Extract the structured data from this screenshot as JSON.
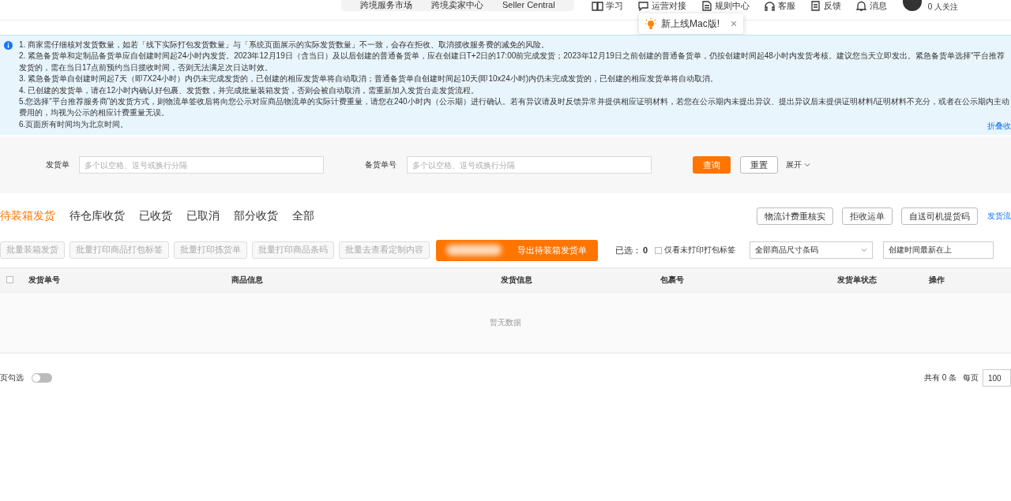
{
  "top_nav": {
    "links": [
      "跨境服务市场",
      "跨境卖家中心",
      "Seller Central"
    ],
    "items": [
      {
        "label": "学习"
      },
      {
        "label": "运营对接"
      },
      {
        "label": "规则中心"
      },
      {
        "label": "客服"
      },
      {
        "label": "反馈"
      },
      {
        "label": "消息"
      }
    ],
    "follow": "0 人关注"
  },
  "tooltip": {
    "text": "新上线Mac版!",
    "close": "×"
  },
  "notice": {
    "lines": [
      "1. 商家需仔细核对发货数量，如若「线下实际打包发货数量」与「系统页面展示的实际发货数量」不一致，会存在拒收、取消揽收服务费的减免的风险。",
      "2. 紧急备货单和定制品备货单应自创建时间起24小时内发货。2023年12月19日（含当日）及以后创建的普通备货单，应在创建日T+2日的17:00前完成发货；2023年12月19日之前创建的普通备货单，仍按创建时间起48小时内发货考核。建议您当天立即发出。紧急备货单选择“平台推荐",
      "发货的，需在当日17点前预约当日揽收时间，否则无法满足次日达时效。",
      "3. 紧急备货单自创建时间起7天（即7X24小时）内仍未完成发货的，已创建的相应发货单将自动取消；普通备货单自创建时间起10天(即10x24小时)内仍未完成发货的，已创建的相应发货单将自动取消。",
      "4. 已创建的发货单，请在12小时内确认好包裹、发货数，并完成批量装箱发货，否则会被自动取消，需重新加入发货台走发货流程。",
      "5.您选择“平台推荐服务商”的发货方式，则物流单签收后将向您公示对应商品物流单的实际计费重量，请您在240小时内（公示期）进行确认。若有异议请及时反馈异常并提供相应证明材料，若您在公示期内未提出异议、提出异议后未提供证明材料/证明材料不充分，或者在公示期内主动",
      "费用的，均视为公示的相应计费重量无误。",
      "6.页面所有时间均为北京时间。"
    ],
    "collapse_link": "折叠收"
  },
  "filters": [
    {
      "label": "发货单",
      "placeholder": "多个以空格、逗号或换行分隔"
    },
    {
      "label": "备货单号",
      "placeholder": "多个以空格、逗号或换行分隔"
    }
  ],
  "filter_buttons": {
    "search": "查询",
    "reset": "重置",
    "expand": "展开"
  },
  "tabs": [
    {
      "label": "待装箱发货",
      "selected": true
    },
    {
      "label": "待仓库收货",
      "selected": false
    },
    {
      "label": "已收货",
      "selected": false
    },
    {
      "label": "已取消",
      "selected": false
    },
    {
      "label": "部分收货",
      "selected": false
    },
    {
      "label": "全部",
      "selected": false
    }
  ],
  "action_buttons": [
    "物流计费重核实",
    "拒收运单",
    "自送司机提货码"
  ],
  "process_link": "发货流",
  "batch_buttons": [
    {
      "label": "批量装箱发货",
      "disabled": true
    },
    {
      "label": "批量打印商品打包标签",
      "disabled": true
    },
    {
      "label": "批量打印拣货单",
      "disabled": true
    },
    {
      "label": "批量打印商品条码",
      "disabled": true
    },
    {
      "label": "批量去查看定制内容",
      "disabled": true
    }
  ],
  "export_button": "导出待装箱发货单",
  "selected_count": {
    "label": "已选：",
    "value": "0"
  },
  "unprinted_filter": {
    "label": "仅看未打印打包标签",
    "checked": false
  },
  "selects": [
    "全部商品尺寸条码",
    "创建时间最新在上"
  ],
  "table": {
    "header_checked": false,
    "columns": [
      "发货单号",
      "商品信息",
      "发货信息",
      "包裹号",
      "发货单状态",
      "操作"
    ],
    "empty_text": "暂无数据"
  },
  "footer": {
    "cross_page_label": "页勾选",
    "cross_page_on": false,
    "total": "共有 0 条",
    "per_page_label": "每页",
    "per_page": "100"
  }
}
